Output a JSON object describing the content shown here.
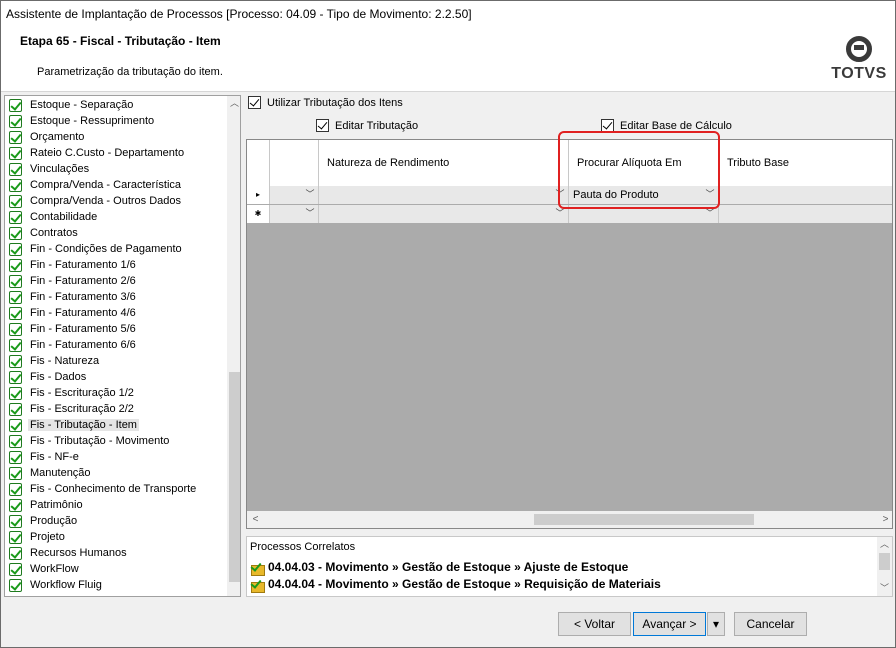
{
  "window": {
    "title": "Assistente de Implantação de Processos [Processo: 04.09 - Tipo de Movimento: 2.2.50]"
  },
  "header": {
    "step": "Etapa 65 - Fiscal - Tributação - Item",
    "description": "Parametrização da tributação do item.",
    "logo_text": "TOTVS"
  },
  "tree": {
    "items": [
      "Estoque - Separação",
      "Estoque - Ressuprimento",
      "Orçamento",
      "Rateio C.Custo - Departamento",
      "Vinculações",
      "Compra/Venda - Característica",
      "Compra/Venda - Outros Dados",
      "Contabilidade",
      "Contratos",
      "Fin - Condições de Pagamento",
      "Fin - Faturamento 1/6",
      "Fin - Faturamento 2/6",
      "Fin - Faturamento 3/6",
      "Fin - Faturamento 4/6",
      "Fin - Faturamento 5/6",
      "Fin - Faturamento 6/6",
      "Fis - Natureza",
      "Fis - Dados",
      "Fis - Escrituração 1/2",
      "Fis - Escrituração 2/2",
      "Fis - Tributação - Item",
      "Fis - Tributação - Movimento",
      "Fis - NF-e",
      "Manutenção",
      "Fis - Conhecimento de Transporte",
      "Patrimônio",
      "Produção",
      "Projeto",
      "Recursos Humanos",
      "WorkFlow",
      "Workflow Fluig"
    ],
    "selected": "Fis - Tributação - Item"
  },
  "options": {
    "use_tax_items": "Utilizar Tributação dos Itens",
    "edit_tax": "Editar Tributação",
    "edit_base": "Editar Base de Cálculo"
  },
  "grid": {
    "columns": [
      "Natureza de Rendimento",
      "Procurar Alíquota Em",
      "Tributo Base"
    ],
    "rows": [
      {
        "marker": "▸",
        "natureza": "",
        "procurar": "Pauta do Produto",
        "tributo": ""
      },
      {
        "marker": "✱",
        "natureza": "",
        "procurar": "",
        "tributo": ""
      }
    ]
  },
  "related": {
    "title": "Processos Correlatos",
    "items": [
      "04.04.03 - Movimento » Gestão de Estoque » Ajuste de Estoque",
      "04.04.04 - Movimento » Gestão de Estoque » Requisição de Materiais"
    ]
  },
  "buttons": {
    "back": "< Voltar",
    "next": "Avançar >",
    "next_menu": "▾",
    "cancel": "Cancelar"
  },
  "colors": {
    "highlight": "#e02020",
    "check": "#1a9a1a"
  }
}
